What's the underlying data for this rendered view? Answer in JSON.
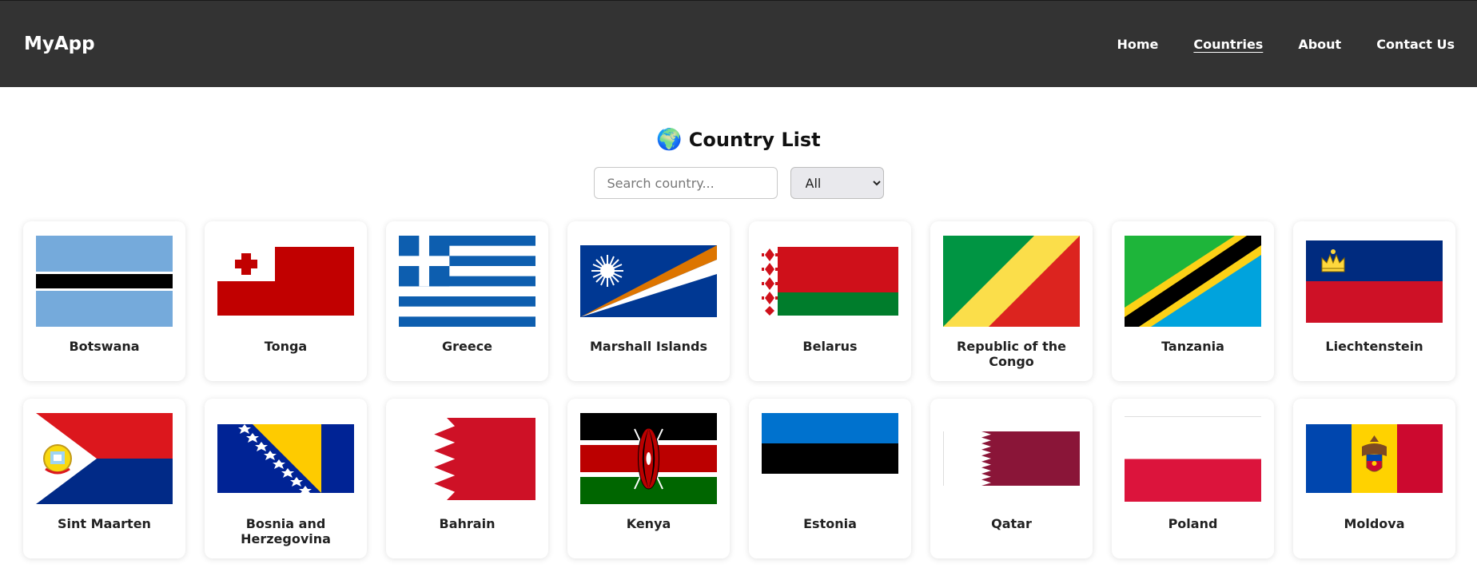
{
  "navbar": {
    "brand": "MyApp",
    "links": [
      {
        "label": "Home"
      },
      {
        "label": "Countries"
      },
      {
        "label": "About"
      },
      {
        "label": "Contact Us"
      }
    ]
  },
  "page": {
    "icon": "🌍",
    "title": "Country List"
  },
  "search": {
    "placeholder": "Search country...",
    "value": ""
  },
  "filter": {
    "selected": "All"
  },
  "countries": [
    {
      "name": "Botswana",
      "flag": "botswana-flag-icon"
    },
    {
      "name": "Tonga",
      "flag": "tonga-flag-icon"
    },
    {
      "name": "Greece",
      "flag": "greece-flag-icon"
    },
    {
      "name": "Marshall Islands",
      "flag": "marshall-islands-flag-icon"
    },
    {
      "name": "Belarus",
      "flag": "belarus-flag-icon"
    },
    {
      "name": "Republic of the Congo",
      "flag": "congo-flag-icon"
    },
    {
      "name": "Tanzania",
      "flag": "tanzania-flag-icon"
    },
    {
      "name": "Liechtenstein",
      "flag": "liechtenstein-flag-icon"
    },
    {
      "name": "Sint Maarten",
      "flag": "sint-maarten-flag-icon"
    },
    {
      "name": "Bosnia and Herzegovina",
      "flag": "bosnia-flag-icon"
    },
    {
      "name": "Bahrain",
      "flag": "bahrain-flag-icon"
    },
    {
      "name": "Kenya",
      "flag": "kenya-flag-icon"
    },
    {
      "name": "Estonia",
      "flag": "estonia-flag-icon"
    },
    {
      "name": "Qatar",
      "flag": "qatar-flag-icon"
    },
    {
      "name": "Poland",
      "flag": "poland-flag-icon"
    },
    {
      "name": "Moldova",
      "flag": "moldova-flag-icon"
    }
  ],
  "colors": {
    "navbar_bg": "#333333",
    "page_bg": "#ffffff",
    "card_bg": "#ffffff"
  }
}
